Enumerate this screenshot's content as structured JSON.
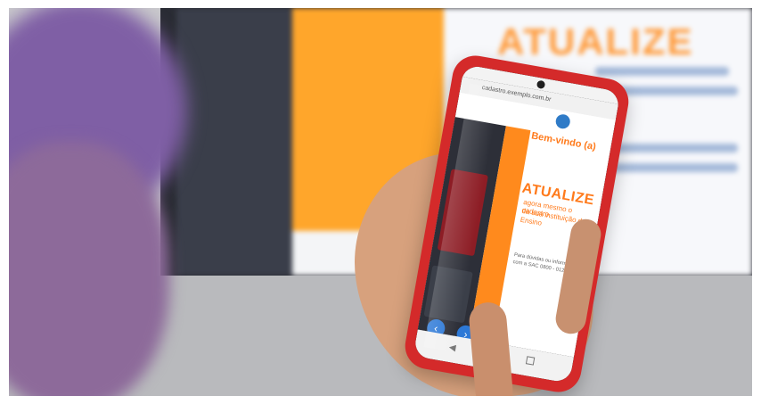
{
  "monitor": {
    "headline": "ATUALIZE"
  },
  "phone": {
    "url": "cadastro.exemplo.com.br",
    "welcome": "Bem-vindo (a)",
    "headline": "ATUALIZE",
    "subheadline_1": "agora mesmo o cadastro",
    "subheadline_2": "da sua instituição de",
    "subheadline_3": "Ensino",
    "help_1": "Para dúvidas ou informações, entre em contato",
    "help_2": "com a SAC 0800 - 0123276 (horário comercial)",
    "nav": {
      "back": "◀"
    }
  }
}
